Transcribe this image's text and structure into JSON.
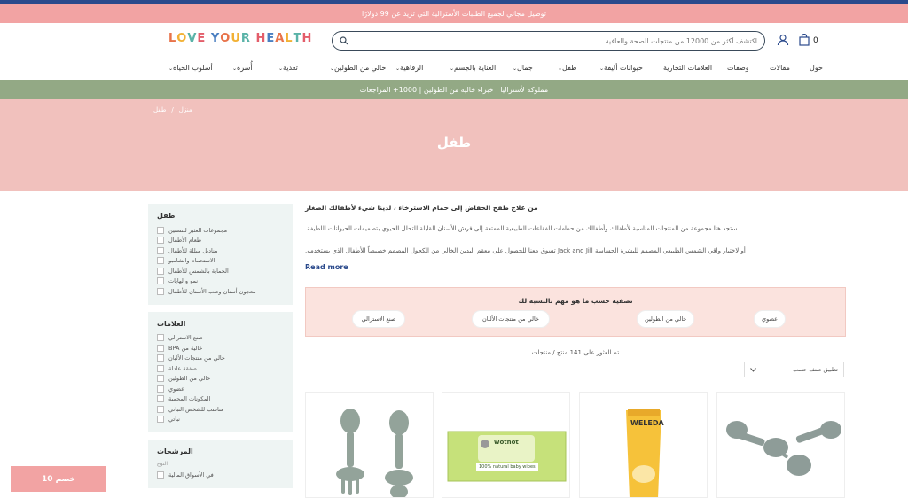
{
  "promo": {
    "text": "توصيل مجاني لجميع الطلبات الأسترالية التي تزيد عن 99 دولارًا"
  },
  "header": {
    "logo": {
      "letters": [
        "L",
        "O",
        "V",
        "E",
        " ",
        "Y",
        "O",
        "U",
        "R",
        " ",
        "H",
        "E",
        "A",
        "L",
        "T",
        "H"
      ],
      "colors": [
        "#e8734a",
        "#f2b134",
        "#5ab3a8",
        "#e35d6a",
        "#ffffff",
        "#4a7fc1",
        "#e8734a",
        "#f2b134",
        "#5ab3a8",
        "#ffffff",
        "#e35d6a",
        "#4a7fc1",
        "#e8734a",
        "#f2b134",
        "#5ab3a8",
        "#e35d6a"
      ]
    },
    "search_placeholder": "اكتشف أكثر من 12000 من منتجات الصحة والعافية",
    "cart_count": "0"
  },
  "nav": {
    "items": [
      {
        "label": "حول"
      },
      {
        "label": "مقالات"
      },
      {
        "label": "وصفات"
      },
      {
        "label": "العلامات التجارية"
      },
      {
        "label": "حيوانات أليفة"
      },
      {
        "label": "طفل"
      },
      {
        "label": "جمال"
      },
      {
        "label": "العناية بالجسم"
      },
      {
        "label": "الرفاهية"
      },
      {
        "label": "خالي من الطولين"
      },
      {
        "label": "تغذية"
      },
      {
        "label": "أُسرة"
      },
      {
        "label": "أسلوب الحياة"
      }
    ]
  },
  "bar2": {
    "text": "مملوكة لأستراليا | خبراء خالية من الطولين | 1000+ المراجعات"
  },
  "breadcrumb": {
    "home": "منزل",
    "sep": "/",
    "current": "طفل"
  },
  "page_title": "طفل",
  "sidebar": {
    "categories": {
      "title": "طفل",
      "items": [
        "مجموعات العثير للتسنين",
        "طعام الأطفال",
        "مناديل مبللة للأطفال",
        "الاستحمام والشامبو",
        "الحماية بالشمس للأطفال",
        "نمو و لهايات",
        "معجون أسنان وطب الأسنان للأطفال"
      ]
    },
    "brands": {
      "title": "العلامات",
      "items": [
        "صنع الاسترالي",
        "BPA خالية من",
        "خالي من منتجات الألبان",
        "صفقة عادلة",
        "خالي من الطولين",
        "عضوي",
        "المكونات المحمية",
        "مناسب للشخص النباتي",
        "نباتي"
      ]
    },
    "filters": {
      "title": "المرشحات",
      "sub": "النوع",
      "first_item": "في الأسواق المالية"
    }
  },
  "content": {
    "intro": "من علاج طفح الحفاض إلى حمام الاسترخاء ، لدينا شيء لأطفالك الصغار",
    "para1": "ستجد هنا مجموعة من المنتجات المناسبة لأطفالك وأطفالك من حمامات الفقاعات الطبيعية الممتعة إلى فرش الأسنان القابلة للتحلل الحيوي بتصميمات الحيوانات اللطيفة.",
    "para2": "أو لاختيار واقي الشمس الطبيعي المصمم للبشرة الحساسة Jack and Jill تسوق معنا للحصول على معقم اليدين الخالي من الكحول المصمم خصيصاً للأطفال الذي يستخدمه.",
    "read_more": "Read more",
    "filter_title": "تصفية حسب ما هو مهم بالنسبة لك",
    "chips": [
      "عضوي",
      "خالي من الطولين",
      "خالي من منتجات الألبان",
      "صنع الاسترالي"
    ],
    "count": "تم العثور على 141 منتج / منتجات",
    "sort": "تطبيق صنف حسب"
  },
  "products": [
    {
      "name": "fork-spoon-set"
    },
    {
      "name": "wotnot-wipes",
      "brand": "wotnot",
      "tagline": "100% natural baby wipes"
    },
    {
      "name": "weleda-baby-cream",
      "brand": "WELEDA"
    },
    {
      "name": "silicone-spoons"
    }
  ],
  "discount_badge": "خصم 10",
  "colors": {
    "promo": "#f2a3a3",
    "bar2": "#93a985",
    "hero": "#f1c1bd",
    "accent": "#2b4a8c"
  }
}
